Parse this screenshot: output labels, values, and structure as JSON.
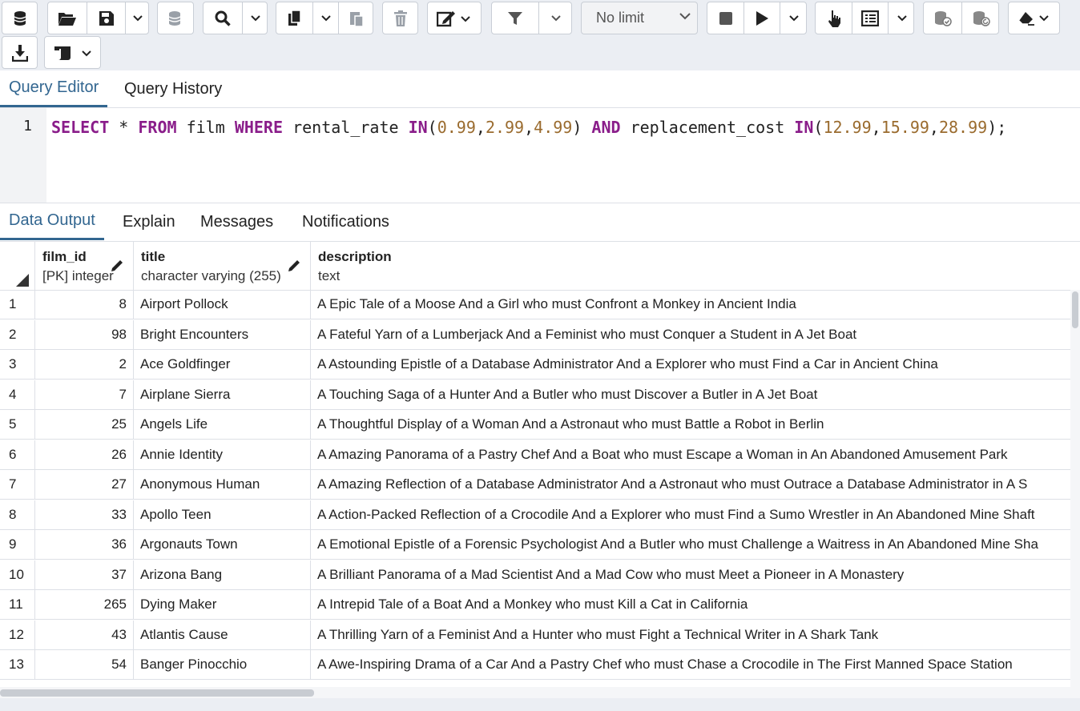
{
  "toolbar": {
    "limit_select": "No limit"
  },
  "query_tabs": [
    {
      "label": "Query Editor"
    },
    {
      "label": "Query History"
    }
  ],
  "editor": {
    "line_number": "1",
    "sql": "SELECT * FROM film WHERE rental_rate IN(0.99,2.99,4.99) AND replacement_cost IN(12.99,15.99,28.99);"
  },
  "output_tabs": [
    {
      "label": "Data Output"
    },
    {
      "label": "Explain"
    },
    {
      "label": "Messages"
    },
    {
      "label": "Notifications"
    }
  ],
  "columns": [
    {
      "name": "film_id",
      "type": "[PK] integer"
    },
    {
      "name": "title",
      "type": "character varying (255)"
    },
    {
      "name": "description",
      "type": "text"
    }
  ],
  "rows": [
    {
      "n": "1",
      "film_id": "8",
      "title": "Airport Pollock",
      "description": "A Epic Tale of a Moose And a Girl who must Confront a Monkey in Ancient India"
    },
    {
      "n": "2",
      "film_id": "98",
      "title": "Bright Encounters",
      "description": "A Fateful Yarn of a Lumberjack And a Feminist who must Conquer a Student in A Jet Boat"
    },
    {
      "n": "3",
      "film_id": "2",
      "title": "Ace Goldfinger",
      "description": "A Astounding Epistle of a Database Administrator And a Explorer who must Find a Car in Ancient China"
    },
    {
      "n": "4",
      "film_id": "7",
      "title": "Airplane Sierra",
      "description": "A Touching Saga of a Hunter And a Butler who must Discover a Butler in A Jet Boat"
    },
    {
      "n": "5",
      "film_id": "25",
      "title": "Angels Life",
      "description": "A Thoughtful Display of a Woman And a Astronaut who must Battle a Robot in Berlin"
    },
    {
      "n": "6",
      "film_id": "26",
      "title": "Annie Identity",
      "description": "A Amazing Panorama of a Pastry Chef And a Boat who must Escape a Woman in An Abandoned Amusement Park"
    },
    {
      "n": "7",
      "film_id": "27",
      "title": "Anonymous Human",
      "description": "A Amazing Reflection of a Database Administrator And a Astronaut who must Outrace a Database Administrator in A S"
    },
    {
      "n": "8",
      "film_id": "33",
      "title": "Apollo Teen",
      "description": "A Action-Packed Reflection of a Crocodile And a Explorer who must Find a Sumo Wrestler in An Abandoned Mine Shaft"
    },
    {
      "n": "9",
      "film_id": "36",
      "title": "Argonauts Town",
      "description": "A Emotional Epistle of a Forensic Psychologist And a Butler who must Challenge a Waitress in An Abandoned Mine Sha"
    },
    {
      "n": "10",
      "film_id": "37",
      "title": "Arizona Bang",
      "description": "A Brilliant Panorama of a Mad Scientist And a Mad Cow who must Meet a Pioneer in A Monastery"
    },
    {
      "n": "11",
      "film_id": "265",
      "title": "Dying Maker",
      "description": "A Intrepid Tale of a Boat And a Monkey who must Kill a Cat in California"
    },
    {
      "n": "12",
      "film_id": "43",
      "title": "Atlantis Cause",
      "description": "A Thrilling Yarn of a Feminist And a Hunter who must Fight a Technical Writer in A Shark Tank"
    },
    {
      "n": "13",
      "film_id": "54",
      "title": "Banger Pinocchio",
      "description": "A Awe-Inspiring Drama of a Car And a Pastry Chef who must Chase a Crocodile in The First Manned Space Station"
    }
  ]
}
